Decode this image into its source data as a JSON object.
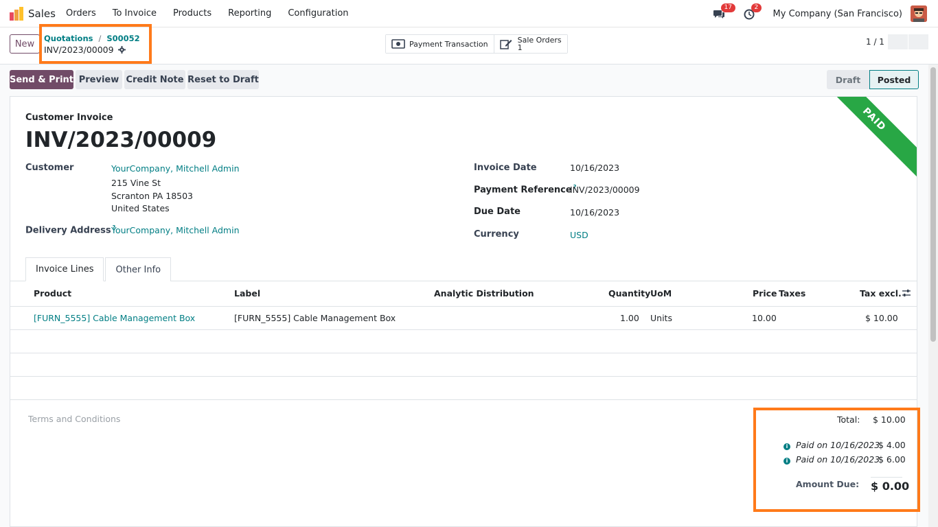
{
  "navbar": {
    "app_name": "Sales",
    "menu": [
      "Orders",
      "To Invoice",
      "Products",
      "Reporting",
      "Configuration"
    ],
    "messages_badge": "17",
    "activity_badge": "2",
    "company": "My Company (San Francisco)"
  },
  "control": {
    "new_label": "New",
    "breadcrumb_1": "Quotations",
    "breadcrumb_2": "S00052",
    "current": "INV/2023/00009",
    "smart_payment": "Payment Transaction",
    "smart_sale_orders": "Sale Orders",
    "smart_sale_orders_count": "1",
    "pager": "1 / 1"
  },
  "actions": {
    "send_print": "Send & Print",
    "preview": "Preview",
    "credit_note": "Credit Note",
    "reset_draft": "Reset to Draft"
  },
  "status": {
    "draft": "Draft",
    "posted": "Posted"
  },
  "ribbon": "PAID",
  "form": {
    "doc_type": "Customer Invoice",
    "title": "INV/2023/00009",
    "customer_label": "Customer",
    "customer": "YourCompany, Mitchell Admin",
    "address_1": "215 Vine St",
    "address_2": "Scranton PA 18503",
    "address_3": "United States",
    "delivery_label": "Delivery Address",
    "delivery": "YourCompany, Mitchell Admin",
    "invoice_date_label": "Invoice Date",
    "invoice_date": "10/16/2023",
    "payment_ref_label": "Payment Reference",
    "payment_ref": "INV/2023/00009",
    "due_date_label": "Due Date",
    "due_date": "10/16/2023",
    "currency_label": "Currency",
    "currency": "USD",
    "help_mark": "?"
  },
  "tabs": [
    "Invoice Lines",
    "Other Info"
  ],
  "table": {
    "headers": [
      "Product",
      "Label",
      "Analytic Distribution",
      "Quantity",
      "UoM",
      "Price",
      "Taxes",
      "Tax excl."
    ],
    "rows": [
      {
        "product": "[FURN_5555] Cable Management Box",
        "label": "[FURN_5555] Cable Management Box",
        "quantity": "1.00",
        "uom": "Units",
        "price": "10.00",
        "taxes": "",
        "subtotal": "$ 10.00"
      }
    ]
  },
  "footer": {
    "terms_placeholder": "Terms and Conditions",
    "total_label": "Total:",
    "total": "$ 10.00",
    "payment_1_label": "Paid on 10/16/2023",
    "payment_1": "$ 4.00",
    "payment_2_label": "Paid on 10/16/2023",
    "payment_2": "$ 6.00",
    "amount_due_label": "Amount Due:",
    "amount_due": "$ 0.00",
    "info_glyph": "i"
  },
  "colors": {
    "brand": "#714b67",
    "link": "#017e84",
    "paid_ribbon": "#28a745",
    "highlight": "#ff7a1a"
  }
}
